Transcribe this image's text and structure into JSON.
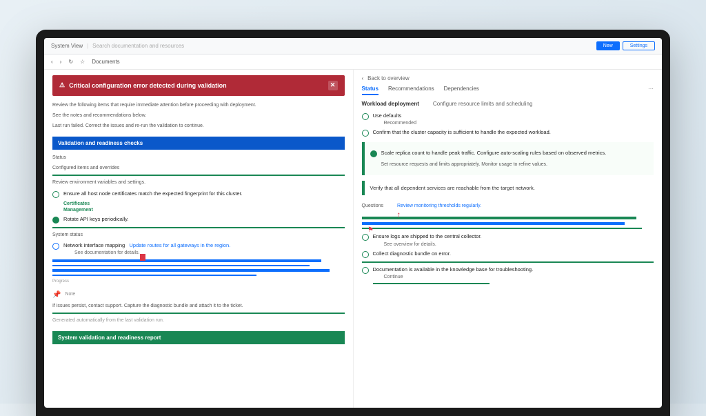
{
  "topbar": {
    "brand": "System View",
    "search_placeholder": "Search documentation and resources",
    "btn_primary": "New",
    "btn_secondary": "Settings"
  },
  "toolbar": {
    "back": "‹",
    "forward": "›",
    "refresh": "↻",
    "bookmark": "☆",
    "label": "Documents"
  },
  "left": {
    "alert": "Critical configuration error detected during validation",
    "intro1": "Review the following items that require immediate attention before proceeding with deployment.",
    "intro2": "See the notes and recommendations below.",
    "intro3": "Last run failed. Correct the issues and re-run the validation to continue.",
    "section1": "Validation and readiness checks",
    "s1a": "Status",
    "s1b": "Configured items and overrides",
    "s1c": "Review environment variables and settings.",
    "item1": "Ensure all host node certificates match the expected fingerprint for this cluster.",
    "item1a": "Certificates",
    "item1b": "Management",
    "item2": "Rotate API keys periodically.",
    "s2": "System status",
    "item3": "Network interface mapping",
    "item3b": "Update routes for all gateways in the region.",
    "item3c": "See documentation for details.",
    "stripes_label": "Progress",
    "note": "Note",
    "note_body": "If issues persist, contact support. Capture the diagnostic bundle and attach it to the ticket.",
    "footer": "System validation and readiness report"
  },
  "right": {
    "back": "Back to overview",
    "tabs": [
      "Status",
      "Recommendations",
      "Dependencies"
    ],
    "heading": "Workload deployment",
    "heading2": "Configure resource limits and scheduling",
    "opt1": "Use defaults",
    "opt1b": "Recommended",
    "opt2": "Confirm that the cluster capacity is sufficient to handle the expected workload.",
    "block1a": "Scale replica count to handle peak traffic. Configure auto-scaling rules based on observed metrics.",
    "block1b": "Set resource requests and limits appropriately. Monitor usage to refine values.",
    "block2": "Verify that all dependent services are reachable from the target network.",
    "q": "Questions",
    "q2": "Review monitoring thresholds regularly.",
    "c1": "Ensure logs are shipped to the central collector.",
    "c1b": "See overview for details.",
    "c2": "Collect diagnostic bundle on error.",
    "c3": "Documentation is available in the knowledge base for troubleshooting.",
    "c3b": "Continue"
  }
}
